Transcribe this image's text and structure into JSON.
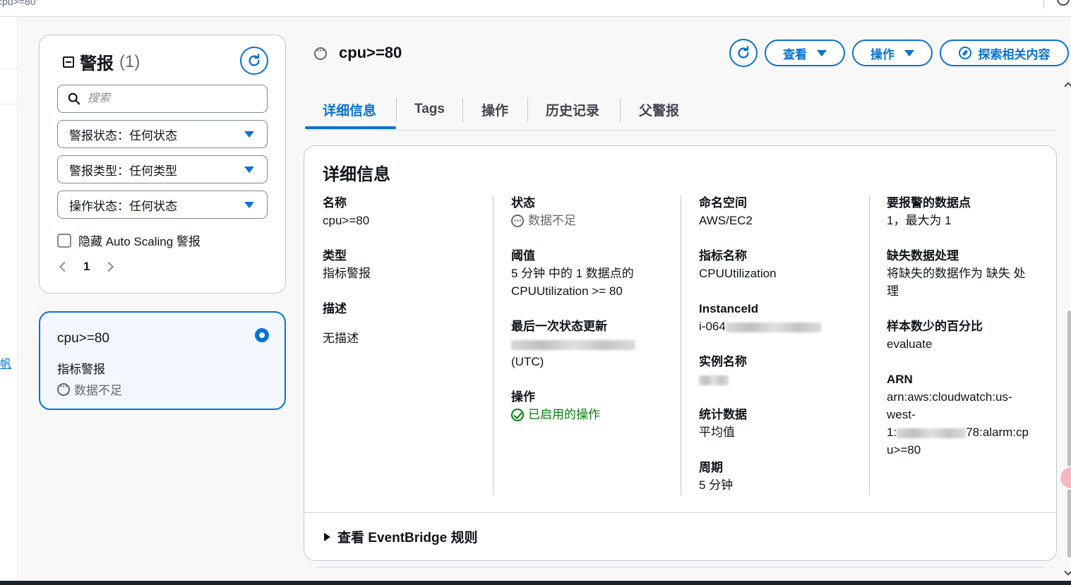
{
  "browser": {
    "tab_title": "cpu>=80"
  },
  "rail": {
    "link_text": "帆"
  },
  "filter_panel": {
    "title": "警报",
    "count": "(1)",
    "search_placeholder": "搜索",
    "selects": [
      "警报状态：任何状态",
      "警报类型：任何类型",
      "操作状态：任何状态"
    ],
    "hide_autoscaling_label": "隐藏 Auto Scaling 警报",
    "current_page": "1"
  },
  "alarm_card": {
    "name": "cpu>=80",
    "type": "指标警报",
    "state": "数据不足"
  },
  "header": {
    "title": "cpu>=80",
    "view_label": "查看",
    "actions_label": "操作",
    "explore_label": "探索相关内容"
  },
  "tabs": [
    "详细信息",
    "Tags",
    "操作",
    "历史记录",
    "父警报"
  ],
  "details": {
    "title": "详细信息",
    "name_key": "名称",
    "name_value": "cpu>=80",
    "type_key": "类型",
    "type_value": "指标警报",
    "desc_key": "描述",
    "desc_value": "无描述",
    "state_key": "状态",
    "state_value": "数据不足",
    "threshold_key": "阈值",
    "threshold_line1": "5 分钟 中的 1 数据点的",
    "threshold_line2": "CPUUtilization >= 80",
    "last_update_key": "最后一次状态更新",
    "last_update_suffix": "(UTC)",
    "actions_key": "操作",
    "actions_value": "已启用的操作",
    "namespace_key": "命名空间",
    "namespace_value": "AWS/EC2",
    "metric_key": "指标名称",
    "metric_value": "CPUUtilization",
    "instance_key": "InstanceId",
    "instance_value_prefix": "i-064",
    "instance_name_key": "实例名称",
    "stat_key": "统计数据",
    "stat_value": "平均值",
    "period_key": "周期",
    "period_value": "5 分钟",
    "datapoints_key": "要报警的数据点",
    "datapoints_value": "1，最大为 1",
    "missing_key": "缺失数据处理",
    "missing_line1": "将缺失的数据作为 缺失 处",
    "missing_line2": "理",
    "percentile_key": "样本数少的百分比",
    "percentile_value": "evaluate",
    "arn_key": "ARN",
    "arn_line1": "arn:aws:cloudwatch:us-",
    "arn_line2": "west-",
    "arn_line3_prefix": "1:",
    "arn_line3_suffix": "78:alarm:cp",
    "arn_line4": "u>=80"
  },
  "expander": {
    "label": "查看 EventBridge 规则"
  },
  "colors": {
    "accent": "#0972d3",
    "success": "#037f0c",
    "muted": "#656871"
  }
}
